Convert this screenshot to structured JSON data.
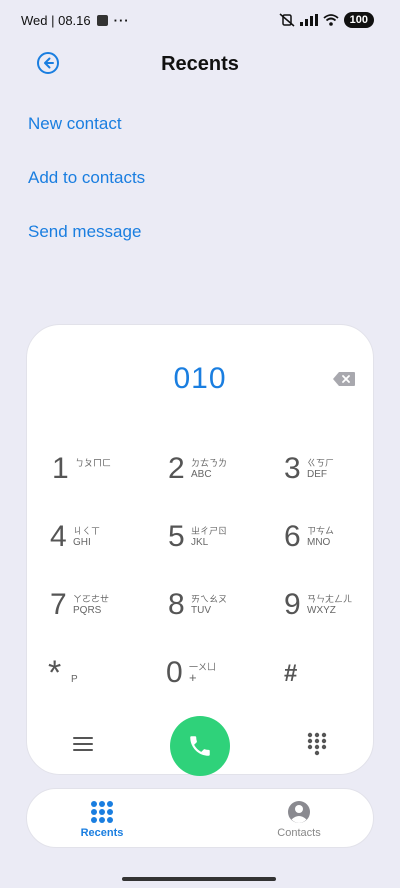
{
  "status_bar": {
    "time": "Wed | 08.16",
    "more": "···",
    "battery": "100"
  },
  "header": {
    "title": "Recents"
  },
  "actions": {
    "new_contact": "New contact",
    "add_to_contacts": "Add to contacts",
    "send_message": "Send message"
  },
  "dialer": {
    "number": "010",
    "keys": [
      {
        "digit": "1",
        "zh": "ㄅㄆㄇㄈ",
        "letters": ""
      },
      {
        "digit": "2",
        "zh": "ㄉㄊㄋㄌ",
        "letters": "ABC"
      },
      {
        "digit": "3",
        "zh": "ㄍㄎㄏ",
        "letters": "DEF"
      },
      {
        "digit": "4",
        "zh": "ㄐㄑㄒ",
        "letters": "GHI"
      },
      {
        "digit": "5",
        "zh": "ㄓㄔㄕㄖ",
        "letters": "JKL"
      },
      {
        "digit": "6",
        "zh": "ㄗㄘㄙ",
        "letters": "MNO"
      },
      {
        "digit": "7",
        "zh": "ㄚㄛㄜㄝ",
        "letters": "PQRS"
      },
      {
        "digit": "8",
        "zh": "ㄞㄟㄠㄡ",
        "letters": "TUV"
      },
      {
        "digit": "9",
        "zh": "ㄢㄣㄤㄥㄦ",
        "letters": "WXYZ"
      },
      {
        "digit": "*",
        "zh": "",
        "letters": "P"
      },
      {
        "digit": "0",
        "zh": "一ㄨㄩ",
        "letters": "+"
      },
      {
        "digit": "#",
        "zh": "",
        "letters": ""
      }
    ]
  },
  "nav": {
    "recents": "Recents",
    "contacts": "Contacts"
  },
  "colors": {
    "accent": "#1a7ee0",
    "call": "#2fd27a",
    "background": "#ebebf5"
  },
  "icons": {
    "back": "back-arrow-icon",
    "backspace": "backspace-icon",
    "call": "phone-icon",
    "menu": "menu-icon",
    "keypad": "keypad-icon",
    "recents": "grid-dots-icon",
    "contacts": "person-icon"
  }
}
